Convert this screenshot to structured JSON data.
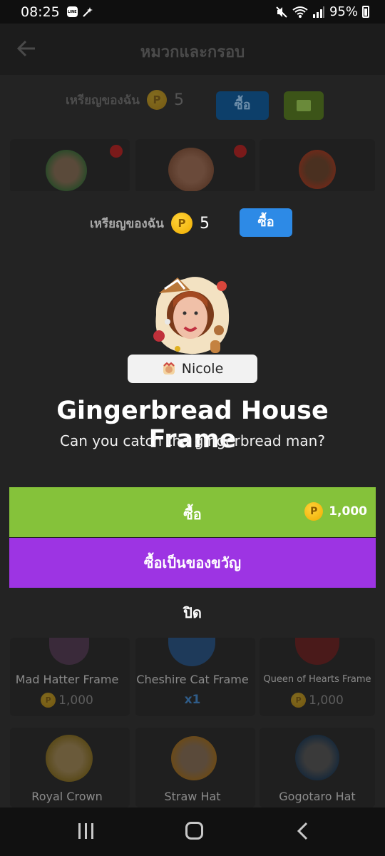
{
  "status_bar": {
    "time": "08:25",
    "line_icon_text": "LINE",
    "battery": "95%"
  },
  "header": {
    "title": "หมวกและกรอบ"
  },
  "coins_bar": {
    "label": "เหรียญของฉัน",
    "count": "5",
    "buy_label": "ซื้อ",
    "coin_symbol": "P"
  },
  "grid_items": [
    {
      "name": "Mad Hatter Frame",
      "price": "1,000",
      "type": "price"
    },
    {
      "name": "Cheshire Cat Frame",
      "price": "x1",
      "type": "qty"
    },
    {
      "name": "Queen of Hearts Frame",
      "price": "1,000",
      "type": "price"
    },
    {
      "name": "Royal Crown",
      "price": "",
      "type": "none"
    },
    {
      "name": "Straw Hat",
      "price": "",
      "type": "none"
    },
    {
      "name": "Gogotaro Hat",
      "price": "",
      "type": "none"
    }
  ],
  "modal": {
    "coins_label": "เหรียญของฉัน",
    "coins_count": "5",
    "buy_small_label": "ซื้อ",
    "user_name": "Nicole",
    "item_title": "Gingerbread House Frame",
    "item_description": "Can you catch the gingerbread man?",
    "buy_label": "ซื้อ",
    "buy_price": "1,000",
    "gift_label": "ซื้อเป็นของขวัญ",
    "close_label": "ปิด"
  },
  "colors": {
    "buy_green": "#85c23a",
    "gift_purple": "#9d34e3",
    "buy_blue": "#2d8ae6",
    "coin_gold": "#f0ad00"
  }
}
